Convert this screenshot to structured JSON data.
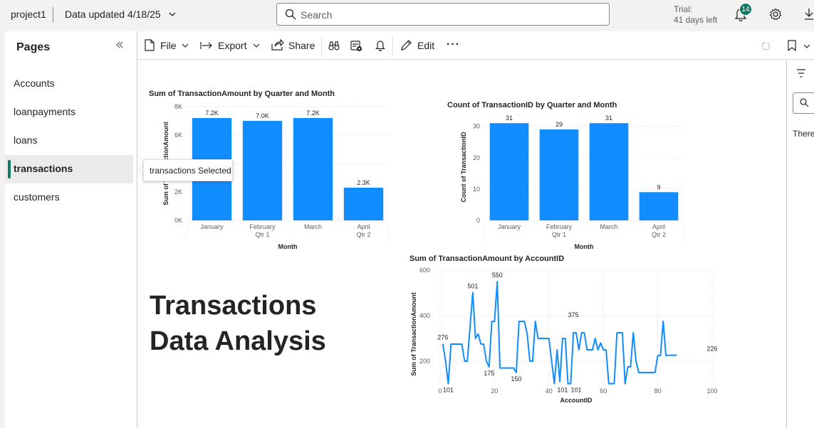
{
  "topbar": {
    "workspace": "project1",
    "data_updated": "Data updated 4/18/25",
    "search_placeholder": "Search",
    "trial_line1": "Trial:",
    "trial_line2": "41 days left",
    "notification_count": "14"
  },
  "pages": {
    "title": "Pages",
    "items": [
      {
        "label": "Accounts",
        "selected": false
      },
      {
        "label": "loanpayments",
        "selected": false
      },
      {
        "label": "loans",
        "selected": false
      },
      {
        "label": "transactions",
        "selected": true
      },
      {
        "label": "customers",
        "selected": false
      }
    ],
    "tooltip": "transactions Selected"
  },
  "toolbar": {
    "file": "File",
    "export": "Export",
    "share": "Share",
    "edit": "Edit",
    "more": "···"
  },
  "right_pane": {
    "text": "There"
  },
  "report": {
    "title_line1": "Transactions",
    "title_line2": "Data Analysis"
  },
  "chart_data": [
    {
      "type": "bar",
      "title": "Sum of TransactionAmount by Quarter and Month",
      "xlabel": "Month",
      "ylabel": "Sum of TransactionAmount",
      "categories": [
        "January",
        "February",
        "March",
        "April"
      ],
      "quarters": [
        "",
        "Qtr 1",
        "",
        "Qtr 2"
      ],
      "values": [
        7200,
        7000,
        7200,
        2300
      ],
      "data_labels": [
        "7.2K",
        "7.0K",
        "7.2K",
        "2.3K"
      ],
      "ylim": [
        0,
        8000
      ],
      "yticks": [
        0,
        2000,
        4000,
        6000,
        8000
      ],
      "ytick_labels": [
        "0K",
        "2K",
        "4K",
        "6K",
        "8K"
      ],
      "color": "#118DFF"
    },
    {
      "type": "bar",
      "title": "Count of TransactionID by Quarter and Month",
      "xlabel": "Month",
      "ylabel": "Count of TransactionID",
      "categories": [
        "January",
        "February",
        "March",
        "April"
      ],
      "quarters": [
        "",
        "Qtr 1",
        "",
        "Qtr 2"
      ],
      "values": [
        31,
        29,
        31,
        9
      ],
      "data_labels": [
        "31",
        "29",
        "31",
        "9"
      ],
      "ylim": [
        0,
        34
      ],
      "yticks": [
        0,
        10,
        20,
        30
      ],
      "ytick_labels": [
        "0",
        "10",
        "20",
        "30"
      ],
      "color": "#118DFF"
    },
    {
      "type": "line",
      "title": "Sum of TransactionAmount by AccountID",
      "xlabel": "AccountID",
      "ylabel": "Sum of TransactionAmount",
      "xlim": [
        0,
        100
      ],
      "ylim": [
        100,
        600
      ],
      "xticks": [
        0,
        20,
        40,
        60,
        80,
        100
      ],
      "yticks": [
        200,
        400,
        600
      ],
      "color": "#118DFF",
      "x": [
        1,
        2,
        3,
        4,
        5,
        6,
        7,
        8,
        9,
        10,
        11,
        12,
        13,
        14,
        15,
        16,
        17,
        18,
        19,
        20,
        21,
        22,
        23,
        24,
        25,
        26,
        27,
        28,
        29,
        30,
        31,
        32,
        33,
        34,
        35,
        36,
        37,
        38,
        39,
        40,
        41,
        42,
        43,
        44,
        45,
        46,
        47,
        48,
        49,
        50,
        51,
        52,
        53,
        54,
        55,
        56,
        57,
        58,
        59,
        60,
        61,
        62,
        63,
        64,
        65,
        66,
        67,
        68,
        69,
        70,
        71,
        72,
        73,
        74,
        75,
        76,
        77,
        78,
        79,
        80,
        81,
        82,
        83,
        84,
        85,
        86,
        87,
        88,
        89,
        90,
        91,
        92,
        93,
        94,
        95,
        96,
        97,
        98,
        99,
        100
      ],
      "y": [
        276,
        200,
        101,
        275,
        275,
        275,
        275,
        275,
        200,
        200,
        350,
        501,
        300,
        320,
        275,
        275,
        200,
        175,
        375,
        375,
        550,
        170,
        170,
        170,
        170,
        170,
        170,
        150,
        375,
        375,
        375,
        320,
        200,
        200,
        375,
        300,
        300,
        300,
        300,
        300,
        200,
        101,
        250,
        110,
        300,
        300,
        101,
        101,
        325,
        325,
        250,
        325,
        325,
        250,
        250,
        250,
        300,
        250,
        280,
        250,
        250,
        101,
        101,
        101,
        325,
        325,
        325,
        101,
        175,
        175,
        325,
        200,
        150,
        150,
        150,
        150,
        150,
        150,
        150,
        225,
        225,
        375,
        225,
        226,
        226,
        226,
        226
      ],
      "annotations": [
        {
          "x": 1,
          "y": 276,
          "label": "276"
        },
        {
          "x": 3,
          "y": 101,
          "label": "101"
        },
        {
          "x": 12,
          "y": 501,
          "label": "501"
        },
        {
          "x": 18,
          "y": 175,
          "label": "175"
        },
        {
          "x": 21,
          "y": 550,
          "label": "550"
        },
        {
          "x": 28,
          "y": 150,
          "label": "150"
        },
        {
          "x": 45,
          "y": 101,
          "label": "101"
        },
        {
          "x": 50,
          "y": 101,
          "label": "101"
        },
        {
          "x": 49,
          "y": 375,
          "label": "375"
        },
        {
          "x": 100,
          "y": 226,
          "label": "226"
        }
      ]
    }
  ]
}
